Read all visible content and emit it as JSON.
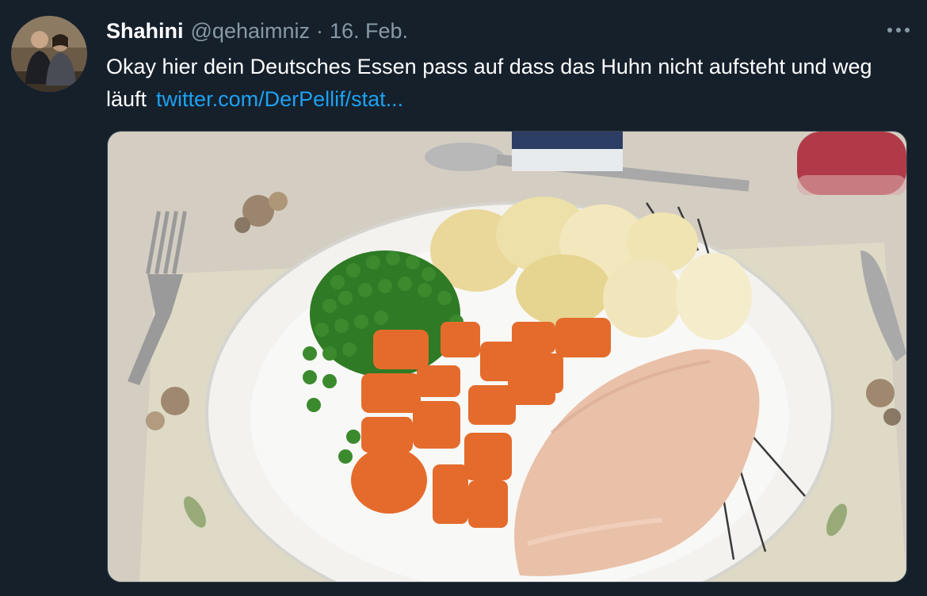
{
  "tweet": {
    "author": {
      "display_name": "Shahini",
      "handle": "@qehaimniz",
      "avatar_icon": "profile-photo"
    },
    "separator": "·",
    "timestamp": "16. Feb.",
    "more_icon": "more-dots-icon",
    "text": "Okay hier dein Deutsches Essen pass auf dass das Huhn nicht aufsteht und weg läuft",
    "link_text": "twitter.com/DerPellif/stat...",
    "media": {
      "type": "photo",
      "icon": "photo-plate-chicken-peas-carrots-potatoes"
    }
  },
  "colors": {
    "background": "#15202b",
    "text_primary": "#ffffff",
    "text_secondary": "#8899a6",
    "link": "#1da1f2",
    "border": "#38444d"
  }
}
